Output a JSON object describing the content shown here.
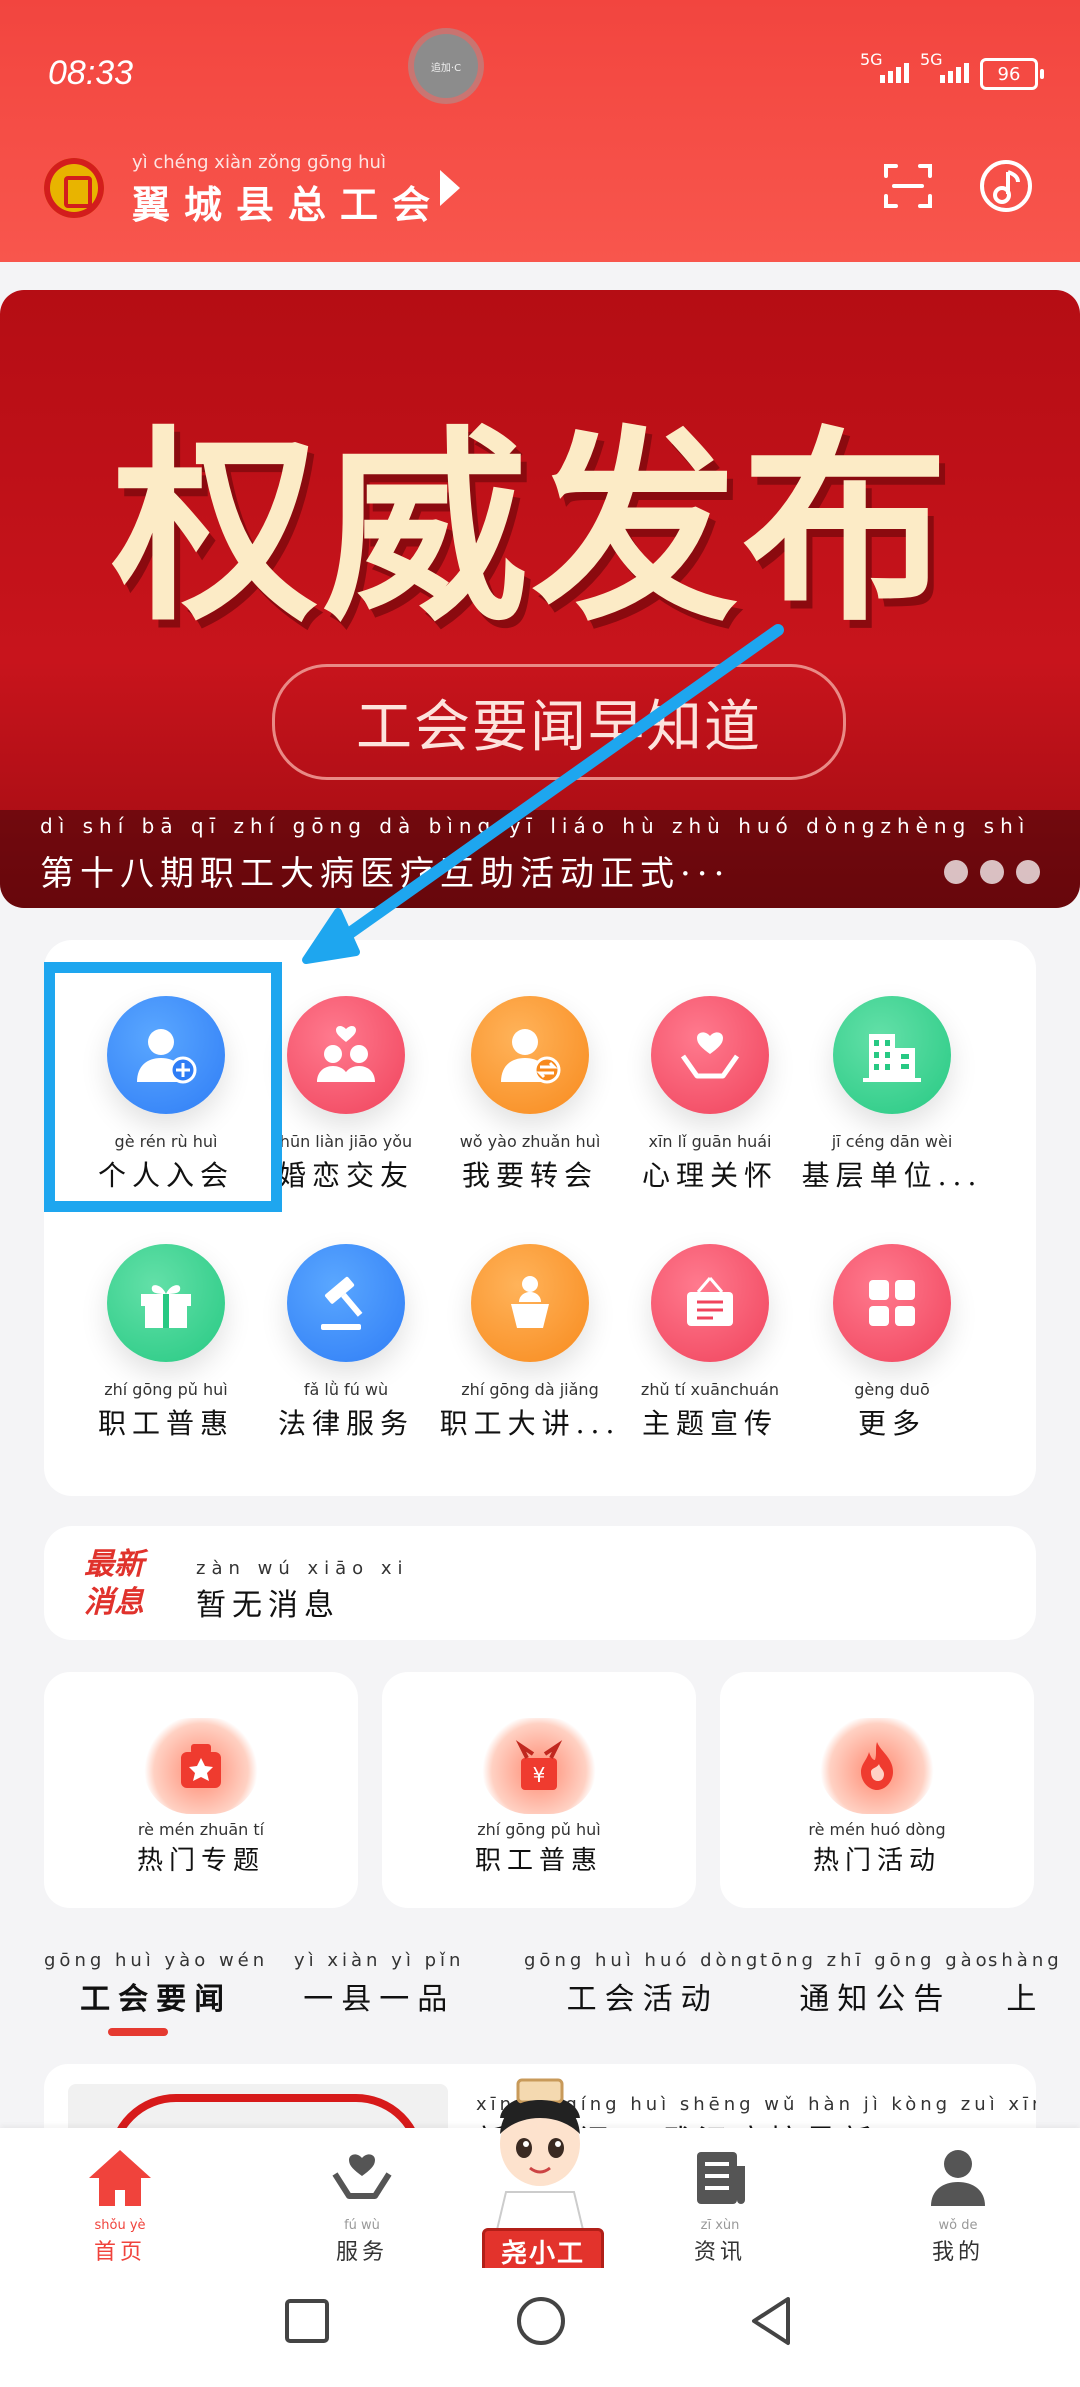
{
  "status_bar": {
    "time": "08:33",
    "camera_label": "追加·C",
    "signal1": "5G",
    "signal2": "5G",
    "battery": "96"
  },
  "header": {
    "logo_icon": "union-emblem-icon",
    "title_pinyin": "yì chéng xiàn zǒng gōng huì",
    "title": "翼城县总工会",
    "scan_icon": "scan-icon",
    "music_icon": "music-icon"
  },
  "banner": {
    "title": "权威发布",
    "subtitle": "工会要闻早知道",
    "caption_pinyin": "dì shí bā qī zhí gōng dà bìng yī liáo hù zhù huó dòngzhèng shì",
    "caption": "第十八期职工大病医疗互助活动正式···"
  },
  "menu": {
    "row1": [
      {
        "pinyin": "gè rén rù huì",
        "label": "个人入会",
        "icon": "person-add-icon",
        "color": "#2f7df6"
      },
      {
        "pinyin": "hūn liàn jiāo yǒu",
        "label": "婚恋交友",
        "icon": "couple-heart-icon",
        "color": "#f0435c"
      },
      {
        "pinyin": "wǒ yào zhuǎn huì",
        "label": "我要转会",
        "icon": "person-transfer-icon",
        "color": "#f88a1d"
      },
      {
        "pinyin": "xīn lǐ guān huái",
        "label": "心理关怀",
        "icon": "heart-hands-icon",
        "color": "#f0435c"
      },
      {
        "pinyin": "jī céng dān wèi",
        "label": "基层单位...",
        "icon": "building-icon",
        "color": "#27c983"
      }
    ],
    "row2": [
      {
        "pinyin": "zhí gōng pǔ huì",
        "label": "职工普惠",
        "icon": "gift-icon",
        "color": "#27c983"
      },
      {
        "pinyin": "fǎ lǜ fú wù",
        "label": "法律服务",
        "icon": "gavel-icon",
        "color": "#2f7df6"
      },
      {
        "pinyin": "zhí gōng dà jiǎng",
        "label": "职工大讲...",
        "icon": "lectern-icon",
        "color": "#f88a1d"
      },
      {
        "pinyin": "zhǔ tí xuānchuán",
        "label": "主题宣传",
        "icon": "signboard-icon",
        "color": "#f0435c"
      },
      {
        "pinyin": "gèng duō",
        "label": "更多",
        "icon": "grid-more-icon",
        "color": "#f0435c"
      }
    ]
  },
  "news": {
    "tag_line1": "最新",
    "tag_line2": "消息",
    "pinyin": "zàn wú xiāo xi",
    "text": "暂无消息"
  },
  "features": [
    {
      "pinyin": "rè mén zhuān tí",
      "label": "热门专题",
      "icon": "star-badge-icon"
    },
    {
      "pinyin": "zhí gōng pǔ huì",
      "label": "职工普惠",
      "icon": "yuan-gift-icon"
    },
    {
      "pinyin": "rè mén huó dòng",
      "label": "热门活动",
      "icon": "fire-icon"
    }
  ],
  "tabs": [
    {
      "pinyin": "gōng huì yào wén",
      "label": "工会要闻"
    },
    {
      "pinyin": "yì xiàn yì pǐn",
      "label": "一县一品"
    },
    {
      "pinyin": "gōng huì huó dòng",
      "label": "工会活动"
    },
    {
      "pinyin": "tōng zhī gōng gào",
      "label": "通知公告"
    },
    {
      "pinyin": "shàng",
      "label": "上"
    }
  ],
  "content_preview": {
    "pinyin": "xīn gǔ qíng huì shēng  wǔ hàn jì kòng zuì xīn",
    "title": "新··情问··  武汉疾控最新"
  },
  "bottom_nav": [
    {
      "pinyin": "shǒu yè",
      "label": "首页",
      "icon": "home-icon",
      "active": true
    },
    {
      "pinyin": "fú wù",
      "label": "服务",
      "icon": "heart-hands-icon",
      "active": false
    },
    {
      "pinyin": "",
      "label": "尧小工",
      "icon": "mascot-icon",
      "active": false
    },
    {
      "pinyin": "zī xùn",
      "label": "资讯",
      "icon": "news-icon",
      "active": false
    },
    {
      "pinyin": "wǒ de",
      "label": "我的",
      "icon": "user-icon",
      "active": false
    }
  ],
  "colors": {
    "primary": "#f0433c",
    "highlight": "#1ea6ef"
  }
}
